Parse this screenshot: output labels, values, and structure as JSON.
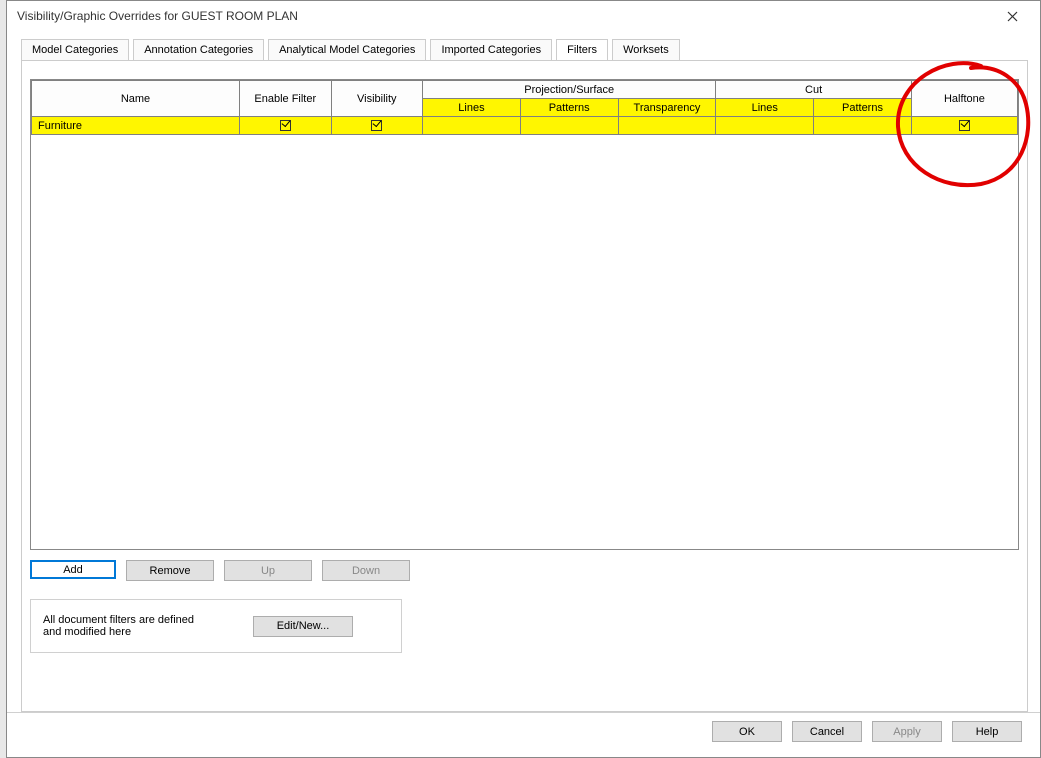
{
  "window": {
    "title": "Visibility/Graphic Overrides for GUEST ROOM PLAN"
  },
  "tabs": {
    "items": [
      {
        "label": "Model Categories"
      },
      {
        "label": "Annotation Categories"
      },
      {
        "label": "Analytical Model Categories"
      },
      {
        "label": "Imported Categories"
      },
      {
        "label": "Filters"
      },
      {
        "label": "Worksets"
      }
    ],
    "activeIndex": 4
  },
  "grid": {
    "headers": {
      "name": "Name",
      "enableFilter": "Enable Filter",
      "visibility": "Visibility",
      "projection": "Projection/Surface",
      "projLines": "Lines",
      "projPatterns": "Patterns",
      "projTransparency": "Transparency",
      "cut": "Cut",
      "cutLines": "Lines",
      "cutPatterns": "Patterns",
      "halftone": "Halftone"
    },
    "rows": [
      {
        "name": "Furniture",
        "enableFilter": true,
        "visibility": true,
        "halftone": true
      }
    ]
  },
  "buttons": {
    "add": "Add",
    "remove": "Remove",
    "up": "Up",
    "down": "Down"
  },
  "note": {
    "text": "All document filters are defined and modified here",
    "editNew": "Edit/New..."
  },
  "dialog": {
    "ok": "OK",
    "cancel": "Cancel",
    "apply": "Apply",
    "help": "Help"
  }
}
